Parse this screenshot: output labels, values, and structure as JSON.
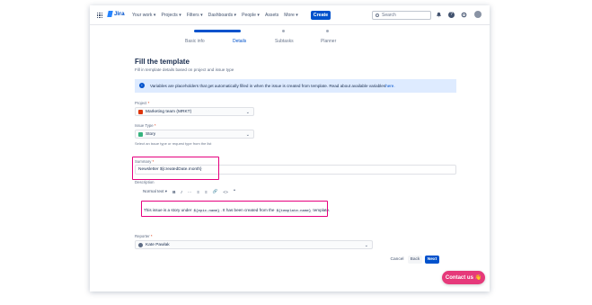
{
  "header": {
    "logo": "Jira",
    "nav": [
      "Your work ▾",
      "Projects ▾",
      "Filters ▾",
      "Dashboards ▾",
      "People ▾",
      "Assets",
      "More ▾"
    ],
    "create_label": "Create",
    "search_placeholder": "Search"
  },
  "steps": [
    {
      "label": "Basic info",
      "state": "done"
    },
    {
      "label": "Details",
      "state": "current"
    },
    {
      "label": "Subtasks",
      "state": "todo"
    },
    {
      "label": "Planner",
      "state": "todo"
    }
  ],
  "form": {
    "title": "Fill the template",
    "subtitle": "Fill in template details based on project and issue type",
    "info_text": "Variables are placeholders that get automatically filled in when the issue is created from template. Read about available variables ",
    "info_link": "here.",
    "project": {
      "label": "Project",
      "required": "*",
      "value": "Marketing team (MRKT)",
      "chevron": "⌄"
    },
    "issue_type": {
      "label": "Issue Type",
      "required": "*",
      "value": "Story",
      "chevron": "⌄"
    },
    "issue_type_hint": "Select an issue type or request type from the list",
    "summary": {
      "label": "Summary",
      "required": "*",
      "value": "Newsletter ${createdDate.month}"
    },
    "description": {
      "label": "Description",
      "toolbar": [
        "Normal text ▾",
        "B",
        "I",
        "···",
        "≡",
        "≡",
        "🔗",
        "<>",
        "❞"
      ],
      "text_a": "This issue is a story under ",
      "code_a": "${epic.name}",
      "text_b": ". It has been created from the ",
      "code_b": "${template.name}",
      "text_c": " template."
    },
    "reporter": {
      "label": "Reporter",
      "required": "*",
      "value": "Kate Pawlak",
      "chevron": "⌄"
    },
    "buttons": {
      "cancel": "Cancel",
      "back": "Back",
      "next": "Next"
    }
  },
  "contact": {
    "label": "Contact us 👋"
  },
  "colors": {
    "accent": "#0052cc",
    "highlight": "#e6007e",
    "contact": "#e6397a"
  }
}
